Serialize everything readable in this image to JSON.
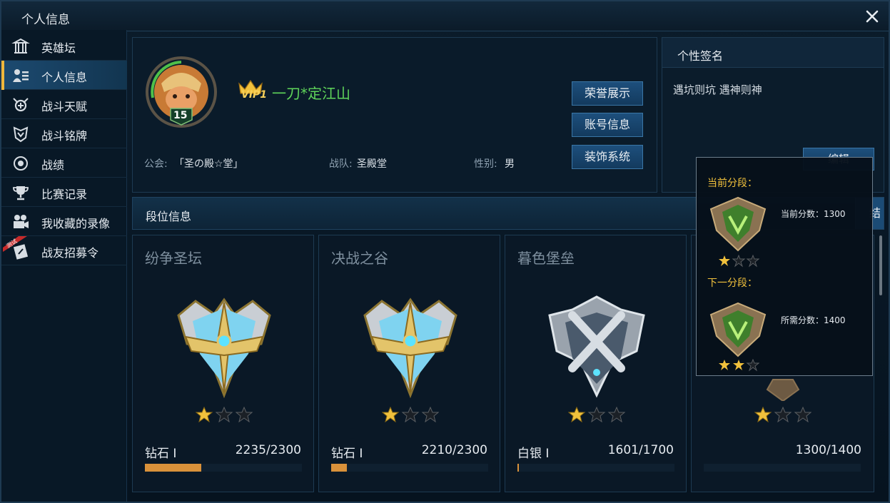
{
  "window": {
    "title": "个人信息",
    "close_icon": "close-icon"
  },
  "sidebar": {
    "items": [
      {
        "label": "英雄坛",
        "icon": "pantheon-icon"
      },
      {
        "label": "个人信息",
        "icon": "profile-icon",
        "active": true
      },
      {
        "label": "战斗天赋",
        "icon": "talent-icon"
      },
      {
        "label": "战斗铭牌",
        "icon": "nameplate-icon"
      },
      {
        "label": "战绩",
        "icon": "record-icon"
      },
      {
        "label": "比赛记录",
        "icon": "trophy-icon"
      },
      {
        "label": "我收藏的录像",
        "icon": "video-icon"
      },
      {
        "label": "战友招募令",
        "icon": "recruit-icon",
        "badge": "测试"
      }
    ]
  },
  "profile": {
    "level": "15",
    "vip": "VIP1",
    "name": "一刀*定江山",
    "guild_label": "公会:",
    "guild": "「圣の殿☆堂」",
    "team_label": "战队:",
    "team": "圣殿堂",
    "gender_label": "性别:",
    "gender": "男",
    "buttons": [
      "荣誉展示",
      "账号信息",
      "装饰系统"
    ]
  },
  "signature": {
    "title": "个性签名",
    "text": "遇坑则坑 遇神则神",
    "edit_label": "编辑"
  },
  "rank": {
    "title": "段位信息",
    "action_label": "结",
    "cards": [
      {
        "mode": "纷争圣坛",
        "tier": "钻石 I",
        "score": "2235/2300",
        "progress": 0.36,
        "stars": 1,
        "emblem": "diamond"
      },
      {
        "mode": "决战之谷",
        "tier": "钻石 I",
        "score": "2210/2300",
        "progress": 0.1,
        "stars": 1,
        "emblem": "diamond"
      },
      {
        "mode": "暮色堡垒",
        "tier": "白银 I",
        "score": "1601/1700",
        "progress": 0.01,
        "stars": 1,
        "emblem": "silver"
      },
      {
        "mode": "",
        "tier": "",
        "score": "1300/1400",
        "progress": 0.0,
        "stars": 1,
        "emblem": "bronze"
      }
    ]
  },
  "tooltip": {
    "current_label": "当前分段：",
    "current_score": "当前分数：1300",
    "current_stars": 1,
    "next_label": "下一分段：",
    "next_score": "所需分数：1400",
    "next_stars": 2
  },
  "colors": {
    "accent": "#f0b73c",
    "name": "#5fd45a",
    "progress": "#d9913a",
    "tooltip_label": "#f1c13c"
  }
}
